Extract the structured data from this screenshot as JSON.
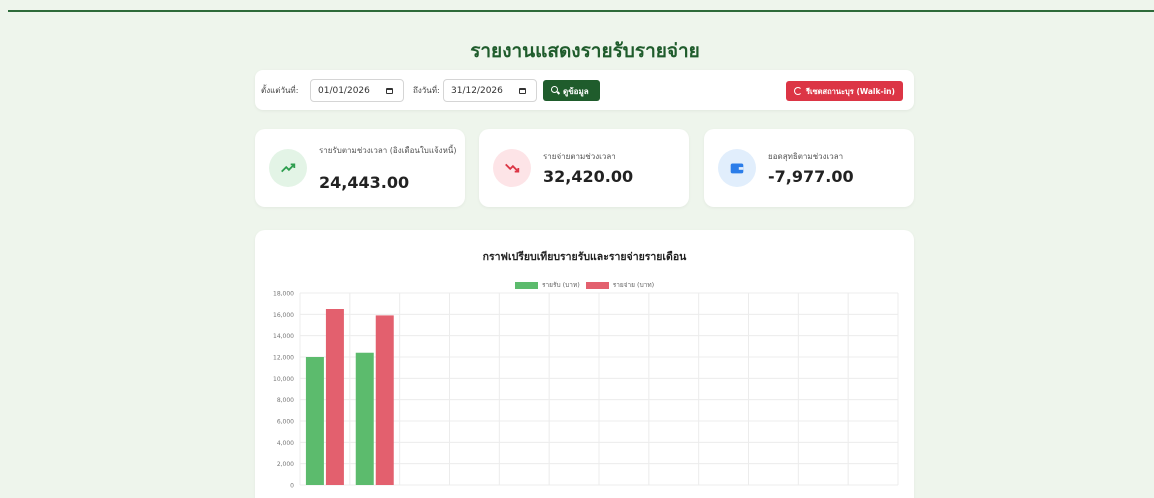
{
  "page": {
    "title": "รายงานแสดงรายรับรายจ่าย"
  },
  "filters": {
    "from_label": "ตั้งแต่วันที่:",
    "from_value": "01/01/2026",
    "to_label": "ถึงวันที่:",
    "to_value": "31/12/2026",
    "search_label": "ดูข้อมูล",
    "reset_label": "รีเซตสถานะบุร (Walk-in)"
  },
  "cards": [
    {
      "label": "รายรับตามช่วงเวลา (อิงเดือนใบแจ้งหนี้)",
      "value": "24,443.00",
      "icon": "trending-up-icon",
      "color": "#2e9e4f"
    },
    {
      "label": "รายจ่ายตามช่วงเวลา",
      "value": "32,420.00",
      "icon": "trending-down-icon",
      "color": "#dc3545"
    },
    {
      "label": "ยอดสุทธิตามช่วงเวลา",
      "value": "-7,977.00",
      "icon": "wallet-icon",
      "color": "#2b7de9"
    }
  ],
  "colors": {
    "accent": "#1f5c2c",
    "income": "#5cbb6d",
    "expense": "#e3606e",
    "reset": "#dc3545"
  },
  "chart_data": {
    "type": "bar",
    "title": "กราฟเปรียบเทียบรายรับและรายจ่ายรายเดือน",
    "categories": [
      "",
      "",
      "",
      "",
      "",
      "",
      "",
      "",
      "",
      "",
      "",
      ""
    ],
    "series": [
      {
        "name": "รายรับ (บาท)",
        "values": [
          12000,
          12400,
          0,
          0,
          0,
          0,
          0,
          0,
          0,
          0,
          0,
          0
        ]
      },
      {
        "name": "รายจ่าย (บาท)",
        "values": [
          16500,
          15900,
          0,
          0,
          0,
          0,
          0,
          0,
          0,
          0,
          0,
          0
        ]
      }
    ],
    "ylim": [
      0,
      18000
    ],
    "yticks": [
      "0",
      "2,000",
      "4,000",
      "6,000",
      "8,000",
      "10,000",
      "12,000",
      "14,000",
      "16,000",
      "18,000"
    ],
    "grid": true,
    "legend": "top-center"
  }
}
